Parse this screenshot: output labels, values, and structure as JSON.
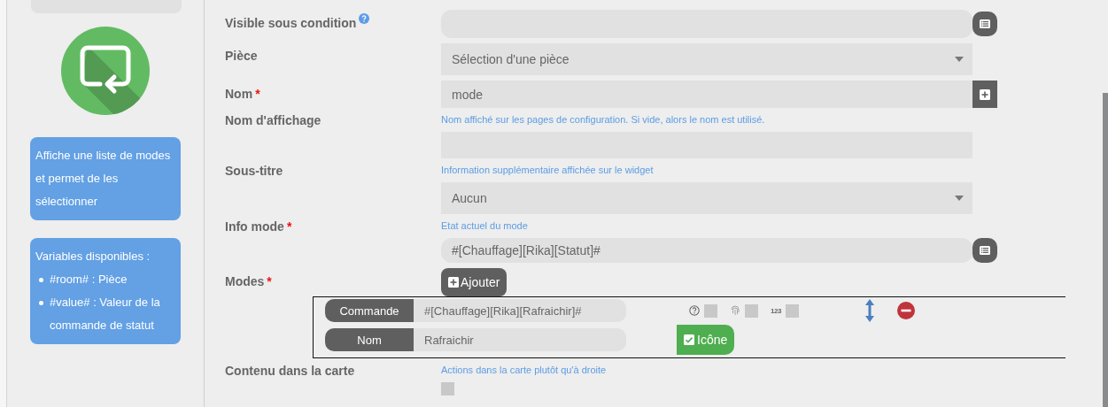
{
  "sidebar": {
    "description": "Affiche une liste de modes et permet de les sélectionner",
    "variables": {
      "title": "Variables disponibles :",
      "items": [
        "#room# : Pièce",
        "#value# : Valeur de la commande de statut"
      ]
    }
  },
  "form": {
    "fields": [
      {
        "kind": "input",
        "label": "Visible sous condition",
        "help": true,
        "button": {
          "kind": "list"
        },
        "rounded": true
      },
      {
        "kind": "select",
        "label": "Pièce",
        "value": "Sélection d'une pièce"
      },
      {
        "kind": "input",
        "label": "Nom",
        "required_mark": "*",
        "value": "mode",
        "button": {
          "kind": "add"
        }
      },
      {
        "kind": "input",
        "label": "Nom d'affichage",
        "hint": "Nom affiché sur les pages de configuration. Si vide, alors le nom est utilisé."
      },
      {
        "kind": "select",
        "label": "Sous-titre",
        "hint": "Information supplémentaire affichée sur le widget",
        "value": "Aucun"
      },
      {
        "kind": "input",
        "label": "Info mode",
        "required_mark": "*",
        "hint": "Etat actuel du mode",
        "value": "#[Chauffage][Rika][Statut]#",
        "button": {
          "kind": "list"
        },
        "rounded": true
      },
      {
        "kind": "modes",
        "label": "Modes",
        "required_mark": "*",
        "add_button": "Ajouter",
        "entries": [
          {
            "command_label": "Commande",
            "command": "#[Chauffage][Rika][Rafraichir]#",
            "name_label": "Nom",
            "name": "Rafraichir",
            "options": [
              {
                "kind": "question",
                "checked": false
              },
              {
                "kind": "fingerprint",
                "checked": false
              },
              {
                "kind": "number",
                "text": "123",
                "checked": false
              }
            ],
            "icon_button": {
              "label": "Icône",
              "checked": true
            }
          }
        ]
      },
      {
        "kind": "checkbox",
        "label": "Contenu dans la carte",
        "hint": "Actions dans la carte plutôt qu'à droite",
        "checked": false
      }
    ]
  }
}
